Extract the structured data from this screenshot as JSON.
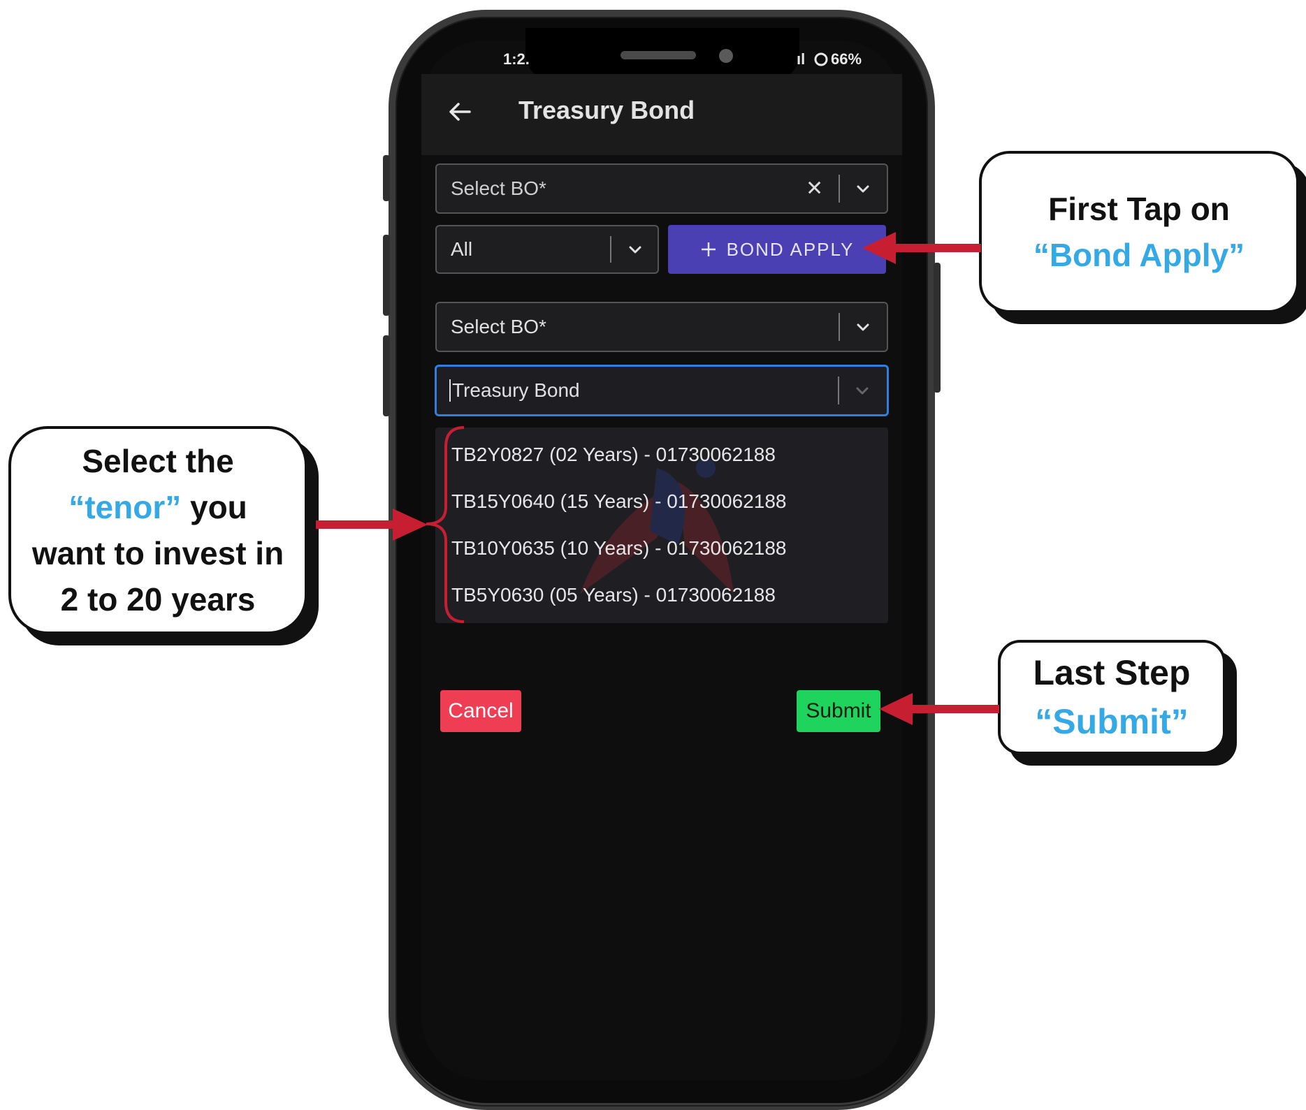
{
  "status_bar": {
    "time": "1:2.",
    "signal": "ıl",
    "battery": "66%"
  },
  "app": {
    "title": "Treasury Bond"
  },
  "form": {
    "select_bo_top": {
      "placeholder": "Select BO*"
    },
    "filter": {
      "value": "All"
    },
    "bond_apply_button": {
      "label": "BOND APPLY"
    },
    "select_bo_second": {
      "value": "Select BO*"
    },
    "bond_type": {
      "value": "Treasury Bond"
    },
    "options": [
      "TB2Y0827 (02 Years) - 01730062188",
      "TB15Y0640 (15 Years) - 01730062188",
      "TB10Y0635 (10 Years) - 01730062188",
      "TB5Y0630 (05 Years) - 01730062188"
    ],
    "cancel_label": "Cancel",
    "submit_label": "Submit"
  },
  "callouts": {
    "bond_apply": {
      "line1": "First Tap on",
      "highlight": "“Bond Apply”"
    },
    "tenor": {
      "line1": "Select the",
      "highlight": "“tenor”",
      "line2_rest": " you",
      "line3": "want to invest in",
      "line4": "2 to 20 years"
    },
    "submit": {
      "line1": "Last Step",
      "highlight": "“Submit”"
    }
  },
  "colors": {
    "accent_blue": "#35a9e6",
    "arrow_red": "#c81e32",
    "bond_apply_bg": "#4b40b3",
    "cancel_bg": "#ef3e54",
    "submit_bg": "#1fd45c",
    "focus_border": "#2f7fe0"
  },
  "icons": [
    "back-arrow-icon",
    "clear-icon",
    "chevron-down-icon",
    "plus-icon",
    "bracket-icon"
  ]
}
